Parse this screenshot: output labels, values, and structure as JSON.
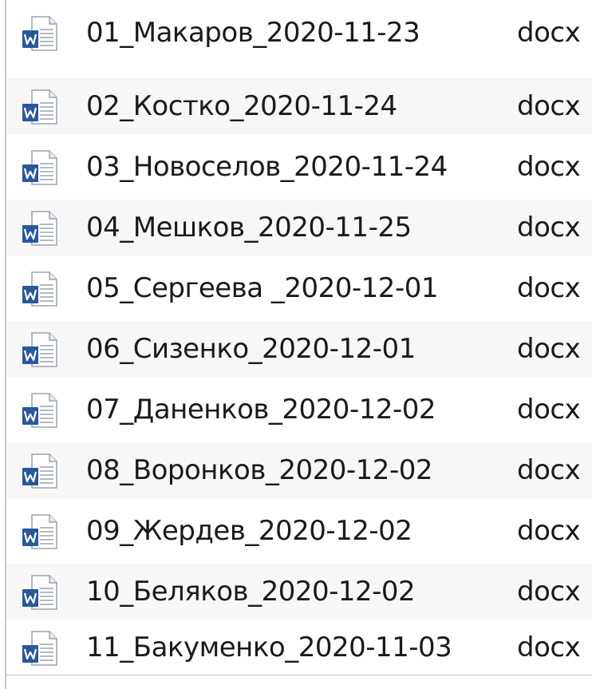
{
  "files": [
    {
      "name": "01_Макаров_2020-11-23",
      "ext": "docx",
      "icon": "word-document-icon"
    },
    {
      "name": "02_Костко_2020-11-24",
      "ext": "docx",
      "icon": "word-document-icon"
    },
    {
      "name": "03_Новоселов_2020-11-24",
      "ext": "docx",
      "icon": "word-document-icon"
    },
    {
      "name": "04_Мешков_2020-11-25",
      "ext": "docx",
      "icon": "word-document-icon"
    },
    {
      "name": "05_Сергеева _2020-12-01",
      "ext": "docx",
      "icon": "word-document-icon"
    },
    {
      "name": "06_Сизенко_2020-12-01",
      "ext": "docx",
      "icon": "word-document-icon"
    },
    {
      "name": "07_Даненков_2020-12-02",
      "ext": "docx",
      "icon": "word-document-icon"
    },
    {
      "name": "08_Воронков_2020-12-02",
      "ext": "docx",
      "icon": "word-document-icon"
    },
    {
      "name": "09_Жердев_2020-12-02",
      "ext": "docx",
      "icon": "word-document-icon"
    },
    {
      "name": "10_Беляков_2020-12-02",
      "ext": "docx",
      "icon": "word-document-icon"
    },
    {
      "name": "11_Бакуменко_2020-11-03",
      "ext": "docx",
      "icon": "word-document-icon"
    }
  ],
  "colors": {
    "word_blue": "#2b579a",
    "row_alt": "#f7f7f7",
    "text": "#1a1a1a"
  }
}
